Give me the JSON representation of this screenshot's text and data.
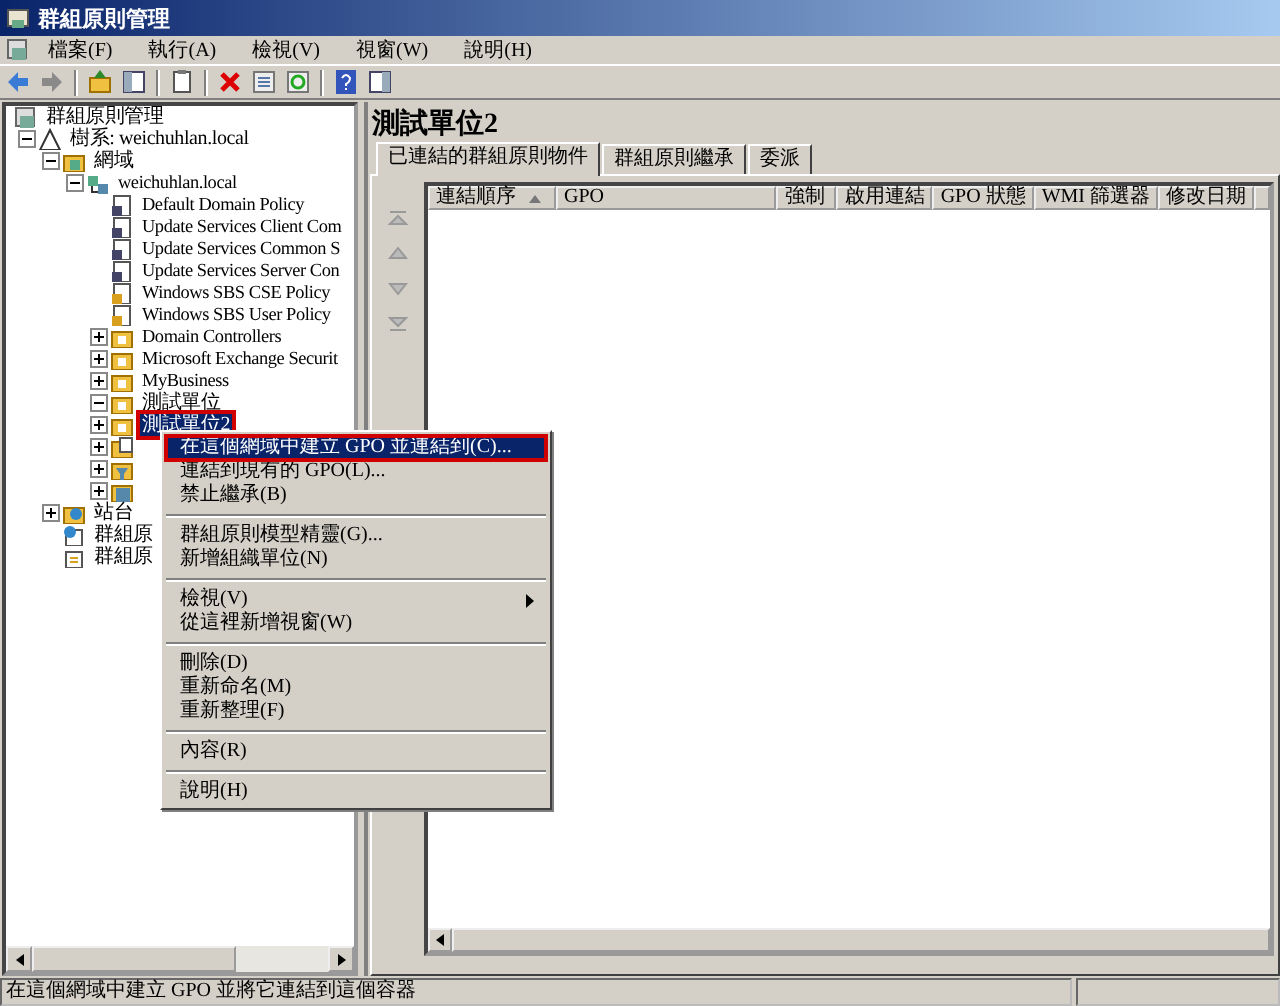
{
  "window": {
    "title": "群組原則管理"
  },
  "menu_bar": [
    {
      "label": "檔案(F)"
    },
    {
      "label": "執行(A)"
    },
    {
      "label": "檢視(V)"
    },
    {
      "label": "視窗(W)"
    },
    {
      "label": "說明(H)"
    }
  ],
  "tree": {
    "items": [
      {
        "label": "群組原則管理",
        "kind": "console",
        "selected": false,
        "children": [
          {
            "label": "樹系: weichuhlan.local",
            "kind": "forest",
            "expanded": true,
            "selected": false,
            "children": [
              {
                "label": "網域",
                "kind": "domains",
                "expanded": true,
                "selected": false,
                "children": [
                  {
                    "label": "weichuhlan.local",
                    "kind": "domain",
                    "expanded": true,
                    "selected": false,
                    "children": [
                      {
                        "label": "Default Domain Policy",
                        "kind": "gpo",
                        "selected": false
                      },
                      {
                        "label": "Update Services Client Com",
                        "kind": "gpo",
                        "selected": false
                      },
                      {
                        "label": "Update Services Common S",
                        "kind": "gpo",
                        "selected": false
                      },
                      {
                        "label": "Update Services Server Con",
                        "kind": "gpo",
                        "selected": false
                      },
                      {
                        "label": "Windows SBS CSE Policy",
                        "kind": "gpo-locked",
                        "selected": false
                      },
                      {
                        "label": "Windows SBS User Policy",
                        "kind": "gpo-locked",
                        "selected": false
                      },
                      {
                        "label": "Domain Controllers",
                        "kind": "ou",
                        "expanded": false,
                        "selected": false
                      },
                      {
                        "label": "Microsoft Exchange Securit",
                        "kind": "ou",
                        "expanded": false,
                        "selected": false
                      },
                      {
                        "label": "MyBusiness",
                        "kind": "ou",
                        "expanded": false,
                        "selected": false
                      },
                      {
                        "label": "測試單位",
                        "kind": "ou",
                        "expanded": true,
                        "selected": false
                      },
                      {
                        "label": "測試單位2",
                        "kind": "ou",
                        "expanded": false,
                        "selected": true,
                        "annotated": true
                      },
                      {
                        "kind": "gpo-folder",
                        "expanded": false,
                        "selected": false
                      },
                      {
                        "kind": "wmi",
                        "expanded": false,
                        "selected": false
                      },
                      {
                        "kind": "starter",
                        "expanded": false,
                        "selected": false
                      }
                    ]
                  }
                ]
              },
              {
                "label": "站台",
                "kind": "sites",
                "expanded": false,
                "selected": false
              },
              {
                "label": "群組原",
                "kind": "modeling",
                "selected": false
              },
              {
                "label": "群組原",
                "kind": "results",
                "selected": false
              }
            ]
          }
        ]
      }
    ]
  },
  "details": {
    "title": "測試單位2",
    "tabs": [
      {
        "label": "已連結的群組原則物件",
        "selected": true
      },
      {
        "label": "群組原則繼承",
        "selected": false
      },
      {
        "label": "委派",
        "selected": false
      }
    ],
    "columns": [
      {
        "label": "連結順序",
        "sorted": true
      },
      {
        "label": "GPO",
        "sorted": false
      },
      {
        "label": "強制",
        "sorted": false
      },
      {
        "label": "啟用連結",
        "sorted": false
      },
      {
        "label": "GPO 狀態",
        "sorted": false
      },
      {
        "label": "WMI 篩選器",
        "sorted": false
      },
      {
        "label": "修改日期",
        "sorted": false
      }
    ]
  },
  "context_menu": {
    "items": [
      {
        "kind": "item",
        "label": "在這個網域中建立 GPO 並連結到(C)...",
        "selected": true,
        "annotated": true
      },
      {
        "kind": "item",
        "label": "連結到現有的 GPO(L)...",
        "selected": false
      },
      {
        "kind": "item",
        "label": "禁止繼承(B)",
        "selected": false
      },
      {
        "kind": "separator"
      },
      {
        "kind": "item",
        "label": "群組原則模型精靈(G)...",
        "selected": false
      },
      {
        "kind": "item",
        "label": "新增組織單位(N)",
        "selected": false
      },
      {
        "kind": "separator"
      },
      {
        "kind": "submenu",
        "label": "檢視(V)",
        "selected": false
      },
      {
        "kind": "item",
        "label": "從這裡新增視窗(W)",
        "selected": false
      },
      {
        "kind": "separator"
      },
      {
        "kind": "item",
        "label": "刪除(D)",
        "selected": false
      },
      {
        "kind": "item",
        "label": "重新命名(M)",
        "selected": false
      },
      {
        "kind": "item",
        "label": "重新整理(F)",
        "selected": false
      },
      {
        "kind": "separator"
      },
      {
        "kind": "item",
        "label": "內容(R)",
        "selected": false
      },
      {
        "kind": "separator"
      },
      {
        "kind": "item",
        "label": "說明(H)",
        "selected": false
      }
    ]
  },
  "status_bar": {
    "text": "在這個網域中建立 GPO 並將它連結到這個容器"
  }
}
